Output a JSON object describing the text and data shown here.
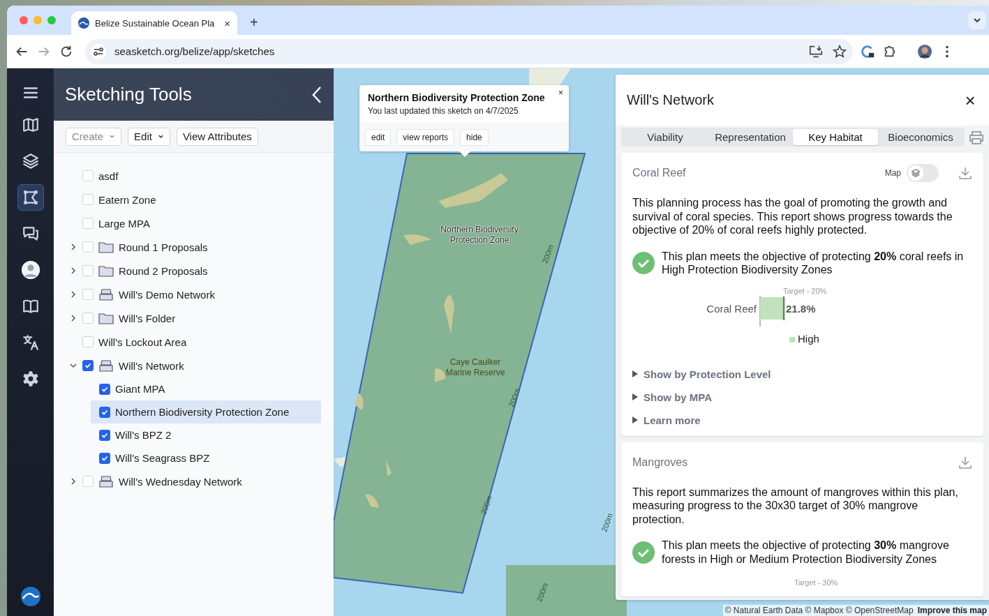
{
  "browser": {
    "tab_title": "Belize Sustainable Ocean Pla",
    "tab_close": "×",
    "new_tab": "+",
    "url": "seasketch.org/belize/app/sketches"
  },
  "rail": {
    "items": [
      {
        "selected": false
      },
      {
        "selected": false
      },
      {
        "selected": true
      },
      {
        "selected": false
      },
      {
        "selected": false
      },
      {
        "selected": false
      },
      {
        "selected": false
      },
      {
        "selected": false
      }
    ]
  },
  "sidebar": {
    "title": "Sketching Tools",
    "toolbar": [
      {
        "label": "Create",
        "dropdown": true,
        "disabled": true
      },
      {
        "label": "Edit",
        "dropdown": true,
        "disabled": false
      },
      {
        "label": "View Attributes",
        "dropdown": false,
        "disabled": false
      }
    ],
    "items": [
      {
        "kind": "sketch",
        "label": "asdf",
        "checked": false,
        "selected": false
      },
      {
        "kind": "sketch",
        "label": "Eatern Zone",
        "checked": false,
        "selected": false
      },
      {
        "kind": "sketch",
        "label": "Large MPA",
        "checked": false,
        "selected": false
      },
      {
        "kind": "folder",
        "label": "Round 1 Proposals",
        "checked": false,
        "selected": false,
        "expanded": false
      },
      {
        "kind": "folder",
        "label": "Round 2 Proposals",
        "checked": false,
        "selected": false,
        "expanded": false
      },
      {
        "kind": "collection",
        "label": "Will's Demo Network",
        "checked": false,
        "selected": false,
        "expanded": false
      },
      {
        "kind": "folder",
        "label": "Will's Folder",
        "checked": false,
        "selected": false,
        "expanded": false
      },
      {
        "kind": "sketch",
        "label": "Will's Lockout Area",
        "checked": false,
        "selected": false
      },
      {
        "kind": "collection",
        "label": "Will's Network",
        "checked": true,
        "selected": false,
        "expanded": true,
        "children": [
          {
            "kind": "sketch",
            "label": "Giant MPA",
            "checked": true,
            "selected": false
          },
          {
            "kind": "sketch",
            "label": "Northern Biodiversity Protection Zone",
            "checked": true,
            "selected": true
          },
          {
            "kind": "sketch",
            "label": "Will's BPZ 2",
            "checked": true,
            "selected": false
          },
          {
            "kind": "sketch",
            "label": "Will's Seagrass BPZ",
            "checked": true,
            "selected": false
          }
        ]
      },
      {
        "kind": "collection",
        "label": "Will's Wednesday Network",
        "checked": false,
        "selected": false,
        "expanded": false
      }
    ]
  },
  "map": {
    "popup": {
      "title": "Northern Biodiversity Protection Zone",
      "subtitle": "You last updated this sketch on 4/7/2025",
      "close": "×",
      "buttons": [
        "edit",
        "view reports",
        "hide"
      ]
    },
    "labels": [
      {
        "kind": "sketch",
        "text": "Northern Biodiversity Protection Zone"
      },
      {
        "kind": "reserve",
        "text": "Caye Caulker Marine Reserve"
      },
      {
        "kind": "depth",
        "text": "200m"
      },
      {
        "kind": "depth",
        "text": "200m"
      },
      {
        "kind": "depth",
        "text": "200m"
      },
      {
        "kind": "depth",
        "text": "200m"
      },
      {
        "kind": "depth",
        "text": "200m"
      }
    ],
    "attribution": "© Natural Earth Data © Mapbox © OpenStreetMap",
    "improve_link": "Improve this map"
  },
  "report": {
    "title": "Will's Network",
    "close": "×",
    "tabs": [
      {
        "label": "Viability",
        "selected": false
      },
      {
        "label": "Representation",
        "selected": false
      },
      {
        "label": "Key Habitat",
        "selected": true
      },
      {
        "label": "Bioeconomics",
        "selected": false
      }
    ],
    "cards": [
      {
        "title": "Coral Reef",
        "map_toggle": {
          "label": "Map",
          "on": false
        },
        "description": "This planning process has the goal of promoting the growth and survival of coral species. This report shows progress towards the objective of 20% of coral reefs highly protected.",
        "objective": "This plan meets the objective of protecting **20%** coral reefs in High Protection Biodiversity Zones",
        "chart_data": {
          "type": "bar",
          "orientation": "horizontal",
          "categories": [
            "Coral Reef"
          ],
          "series": [
            {
              "name": "High",
              "color": "#c2e2bd",
              "values": [
                21.8
              ],
              "value_labels": [
                "21.8%"
              ]
            }
          ],
          "ref_lines": [
            {
              "label": "Target - 20%"
            }
          ]
        },
        "sections": [
          {
            "label": "Show by Protection Level",
            "expanded": false
          },
          {
            "label": "Show by MPA",
            "expanded": false
          },
          {
            "label": "Learn more",
            "expanded": false
          }
        ]
      },
      {
        "title": "Mangroves",
        "description": "This report summarizes the amount of mangroves within this plan, measuring progress to the 30x30 target of 30% mangrove protection.",
        "objective": "This plan meets the objective of protecting **30%** mangrove forests in High or Medium Protection Biodiversity Zones",
        "target_label": "Target - 30%"
      }
    ]
  }
}
